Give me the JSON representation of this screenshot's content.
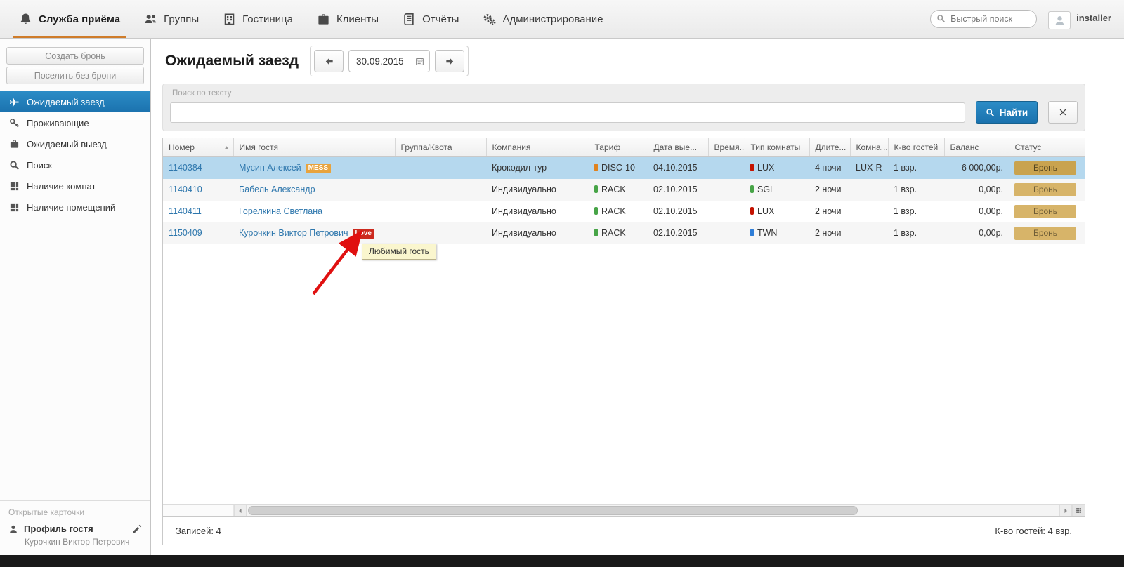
{
  "topnav": {
    "tabs": [
      {
        "id": "reception",
        "icon": "bell",
        "label": "Служба приёма",
        "active": true
      },
      {
        "id": "groups",
        "icon": "people",
        "label": "Группы",
        "active": false
      },
      {
        "id": "hotel",
        "icon": "building",
        "label": "Гостиница",
        "active": false
      },
      {
        "id": "clients",
        "icon": "briefcase",
        "label": "Клиенты",
        "active": false
      },
      {
        "id": "reports",
        "icon": "report",
        "label": "Отчёты",
        "active": false
      },
      {
        "id": "administration",
        "icon": "gears",
        "label": "Администрирование",
        "active": false
      }
    ],
    "quick_search_placeholder": "Быстрый поиск",
    "user": "installer"
  },
  "sidebar": {
    "buttons": [
      {
        "id": "create-booking",
        "label": "Создать бронь"
      },
      {
        "id": "checkin-without-booking",
        "label": "Поселить без брони"
      }
    ],
    "items": [
      {
        "id": "expected-arrival",
        "icon": "airplane",
        "label": "Ожидаемый заезд",
        "active": true
      },
      {
        "id": "residents",
        "icon": "keys",
        "label": "Проживающие",
        "active": false
      },
      {
        "id": "expected-departure",
        "icon": "suitcase",
        "label": "Ожидаемый выезд",
        "active": false
      },
      {
        "id": "search",
        "icon": "search",
        "label": "Поиск",
        "active": false
      },
      {
        "id": "rooms-availability",
        "icon": "grid",
        "label": "Наличие комнат",
        "active": false
      },
      {
        "id": "premises-availability",
        "icon": "grid",
        "label": "Наличие помещений",
        "active": false
      }
    ],
    "open_cards_label": "Открытые карточки",
    "profile": {
      "title": "Профиль гостя",
      "subtitle": "Курочкин Виктор Петрович"
    }
  },
  "main": {
    "title": "Ожидаемый заезд",
    "date": "30.09.2015",
    "search": {
      "label": "Поиск по тексту",
      "value": "",
      "find_label": "Найти"
    },
    "table": {
      "columns": [
        "Номер",
        "Имя гостя",
        "Группа/Квота",
        "Компания",
        "Тариф",
        "Дата вые...",
        "Время...",
        "Тип комнаты",
        "Длите...",
        "Комна...",
        "К-во гостей",
        "Баланс",
        "Статус"
      ],
      "sorted_column": "Номер",
      "rows": [
        {
          "number": "1140384",
          "guest": "Мусин Алексей",
          "guest_badge": {
            "text": "MESS",
            "color": "#e8a33d"
          },
          "group": "",
          "company": "Крокодил-тур",
          "tariff": {
            "text": "DISC-10",
            "color": "#e0821e"
          },
          "departure": "04.10.2015",
          "time": "",
          "room_type": {
            "text": "LUX",
            "color": "#c41200"
          },
          "duration": "4 ночи",
          "room": "LUX-R",
          "guests": "1 взр.",
          "balance": "6 000,00р.",
          "status": "Бронь",
          "selected": true
        },
        {
          "number": "1140410",
          "guest": "Бабель Александр",
          "guest_badge": null,
          "group": "",
          "company": "Индивидуально",
          "tariff": {
            "text": "RACK",
            "color": "#47a447"
          },
          "departure": "02.10.2015",
          "time": "",
          "room_type": {
            "text": "SGL",
            "color": "#47a447"
          },
          "duration": "2 ночи",
          "room": "",
          "guests": "1 взр.",
          "balance": "0,00р.",
          "status": "Бронь",
          "selected": false
        },
        {
          "number": "1140411",
          "guest": "Горелкина Светлана",
          "guest_badge": null,
          "group": "",
          "company": "Индивидуально",
          "tariff": {
            "text": "RACK",
            "color": "#47a447"
          },
          "departure": "02.10.2015",
          "time": "",
          "room_type": {
            "text": "LUX",
            "color": "#c41200"
          },
          "duration": "2 ночи",
          "room": "",
          "guests": "1 взр.",
          "balance": "0,00р.",
          "status": "Бронь",
          "selected": false
        },
        {
          "number": "1150409",
          "guest": "Курочкин Виктор Петрович",
          "guest_badge": {
            "text": "Love",
            "color": "#cc2a1e"
          },
          "group": "",
          "company": "Индивидуально",
          "tariff": {
            "text": "RACK",
            "color": "#47a447"
          },
          "departure": "02.10.2015",
          "time": "",
          "room_type": {
            "text": "TWN",
            "color": "#2f7ed8"
          },
          "duration": "2 ночи",
          "room": "",
          "guests": "1 взр.",
          "balance": "0,00р.",
          "status": "Бронь",
          "selected": false
        }
      ]
    },
    "tooltip": {
      "text": "Любимый гость"
    },
    "annotation": {
      "arrow_color": "#e01010"
    },
    "footer": {
      "records": "Записей: 4",
      "guests": "К-во гостей: 4 взр."
    },
    "colors": {
      "accent_blue": "#1b72ae",
      "selected_row": "#b5d8ee",
      "status_badge": "#d7b469",
      "active_tab_underline": "#cf7c2a"
    }
  }
}
